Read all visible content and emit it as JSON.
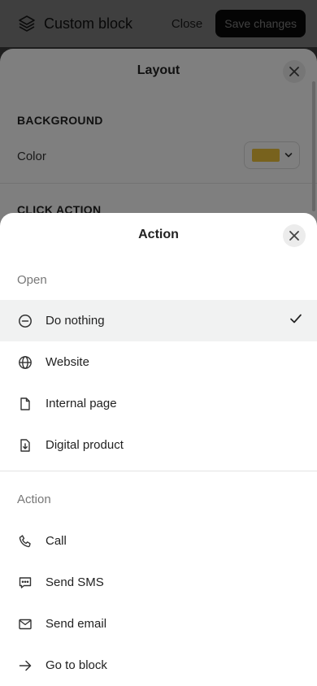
{
  "topbar": {
    "title": "Custom block",
    "close_label": "Close",
    "save_label": "Save changes"
  },
  "layout_sheet": {
    "title": "Layout",
    "background_heading": "BACKGROUND",
    "color_label": "Color",
    "color_value": "#f0c43a",
    "click_action_heading": "CLICK ACTION"
  },
  "action_sheet": {
    "title": "Action",
    "open_group": {
      "label": "Open",
      "items": [
        {
          "label": "Do nothing",
          "icon": "minus-circle-icon",
          "selected": true
        },
        {
          "label": "Website",
          "icon": "globe-icon"
        },
        {
          "label": "Internal page",
          "icon": "file-icon"
        },
        {
          "label": "Digital product",
          "icon": "file-download-icon"
        }
      ]
    },
    "action_group": {
      "label": "Action",
      "items": [
        {
          "label": "Call",
          "icon": "phone-icon"
        },
        {
          "label": "Send SMS",
          "icon": "message-icon"
        },
        {
          "label": "Send email",
          "icon": "mail-icon"
        },
        {
          "label": "Go to block",
          "icon": "arrow-right-icon"
        }
      ]
    }
  }
}
